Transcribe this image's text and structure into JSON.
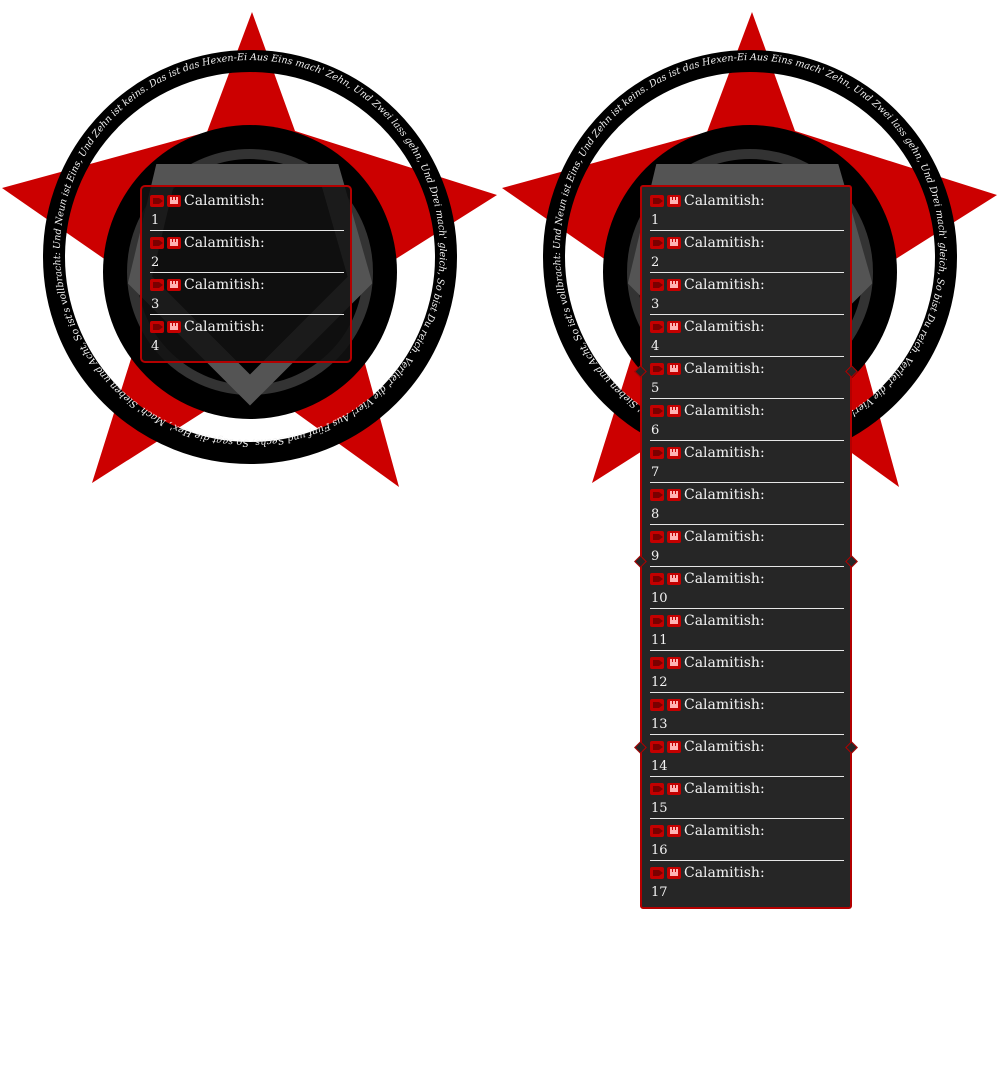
{
  "colors": {
    "star": "#cc0000",
    "ring": "#000000",
    "ring_text": "#f2f2f2",
    "panel_border": "#b30000",
    "panel_bg": "#262626"
  },
  "ring_text": "Aus Eins mach' Zehn, Und Zwei lass gehn, Und Drei mach' gleich, So bist Du reich. Verlier' die Vier! Aus Fünf und Sechs, So sagt die Hex', Mach' Sieben und Acht, So ist's vollbracht: Und Neun ist Eins, Und Zehn ist keins. Das ist das Hexen-Einmal-Eins! Du musst verstehn!",
  "widgets": [
    {
      "messages": [
        {
          "icons": [
            "camera-icon",
            "crown-icon"
          ],
          "user": "Calamitish:",
          "text": "1"
        },
        {
          "icons": [
            "camera-icon",
            "crown-icon"
          ],
          "user": "Calamitish:",
          "text": "2"
        },
        {
          "icons": [
            "camera-icon",
            "crown-icon"
          ],
          "user": "Calamitish:",
          "text": "3"
        },
        {
          "icons": [
            "camera-icon",
            "crown-icon"
          ],
          "user": "Calamitish:",
          "text": "4"
        }
      ]
    },
    {
      "messages": [
        {
          "icons": [
            "camera-icon",
            "crown-icon"
          ],
          "user": "Calamitish:",
          "text": "1"
        },
        {
          "icons": [
            "camera-icon",
            "crown-icon"
          ],
          "user": "Calamitish:",
          "text": "2"
        },
        {
          "icons": [
            "camera-icon",
            "crown-icon"
          ],
          "user": "Calamitish:",
          "text": "3"
        },
        {
          "icons": [
            "camera-icon",
            "crown-icon"
          ],
          "user": "Calamitish:",
          "text": "4"
        },
        {
          "icons": [
            "camera-icon",
            "crown-icon"
          ],
          "user": "Calamitish:",
          "text": "5"
        },
        {
          "icons": [
            "camera-icon",
            "crown-icon"
          ],
          "user": "Calamitish:",
          "text": "6"
        },
        {
          "icons": [
            "camera-icon",
            "crown-icon"
          ],
          "user": "Calamitish:",
          "text": "7"
        },
        {
          "icons": [
            "camera-icon",
            "crown-icon"
          ],
          "user": "Calamitish:",
          "text": "8"
        },
        {
          "icons": [
            "camera-icon",
            "crown-icon"
          ],
          "user": "Calamitish:",
          "text": "9"
        },
        {
          "icons": [
            "camera-icon",
            "crown-icon"
          ],
          "user": "Calamitish:",
          "text": "10"
        },
        {
          "icons": [
            "camera-icon",
            "crown-icon"
          ],
          "user": "Calamitish:",
          "text": "11"
        },
        {
          "icons": [
            "camera-icon",
            "crown-icon"
          ],
          "user": "Calamitish:",
          "text": "12"
        },
        {
          "icons": [
            "camera-icon",
            "crown-icon"
          ],
          "user": "Calamitish:",
          "text": "13"
        },
        {
          "icons": [
            "camera-icon",
            "crown-icon"
          ],
          "user": "Calamitish:",
          "text": "14"
        },
        {
          "icons": [
            "camera-icon",
            "crown-icon"
          ],
          "user": "Calamitish:",
          "text": "15"
        },
        {
          "icons": [
            "camera-icon",
            "crown-icon"
          ],
          "user": "Calamitish:",
          "text": "16"
        },
        {
          "icons": [
            "camera-icon",
            "crown-icon"
          ],
          "user": "Calamitish:",
          "text": "17"
        }
      ]
    }
  ]
}
